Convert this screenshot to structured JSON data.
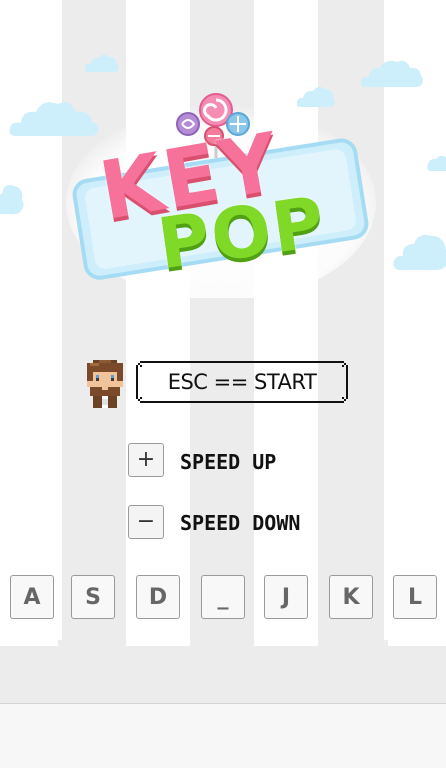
{
  "game": {
    "logo_top": "KEY",
    "logo_bottom": "POP",
    "start_prompt": "ESC == START",
    "speed_up_symbol": "+",
    "speed_up_label": "SPEED UP",
    "speed_down_symbol": "−",
    "speed_down_label": "SPEED DOWN"
  },
  "keys": [
    "A",
    "S",
    "D",
    "_",
    "J",
    "K",
    "L"
  ],
  "colors": {
    "lane_light": "#ffffff",
    "lane_dark": "#ececec",
    "logo_pink": "#f7729b",
    "logo_green": "#7fd926",
    "sign_blue": "#bfe6f7",
    "cloud": "#cdeefb"
  }
}
